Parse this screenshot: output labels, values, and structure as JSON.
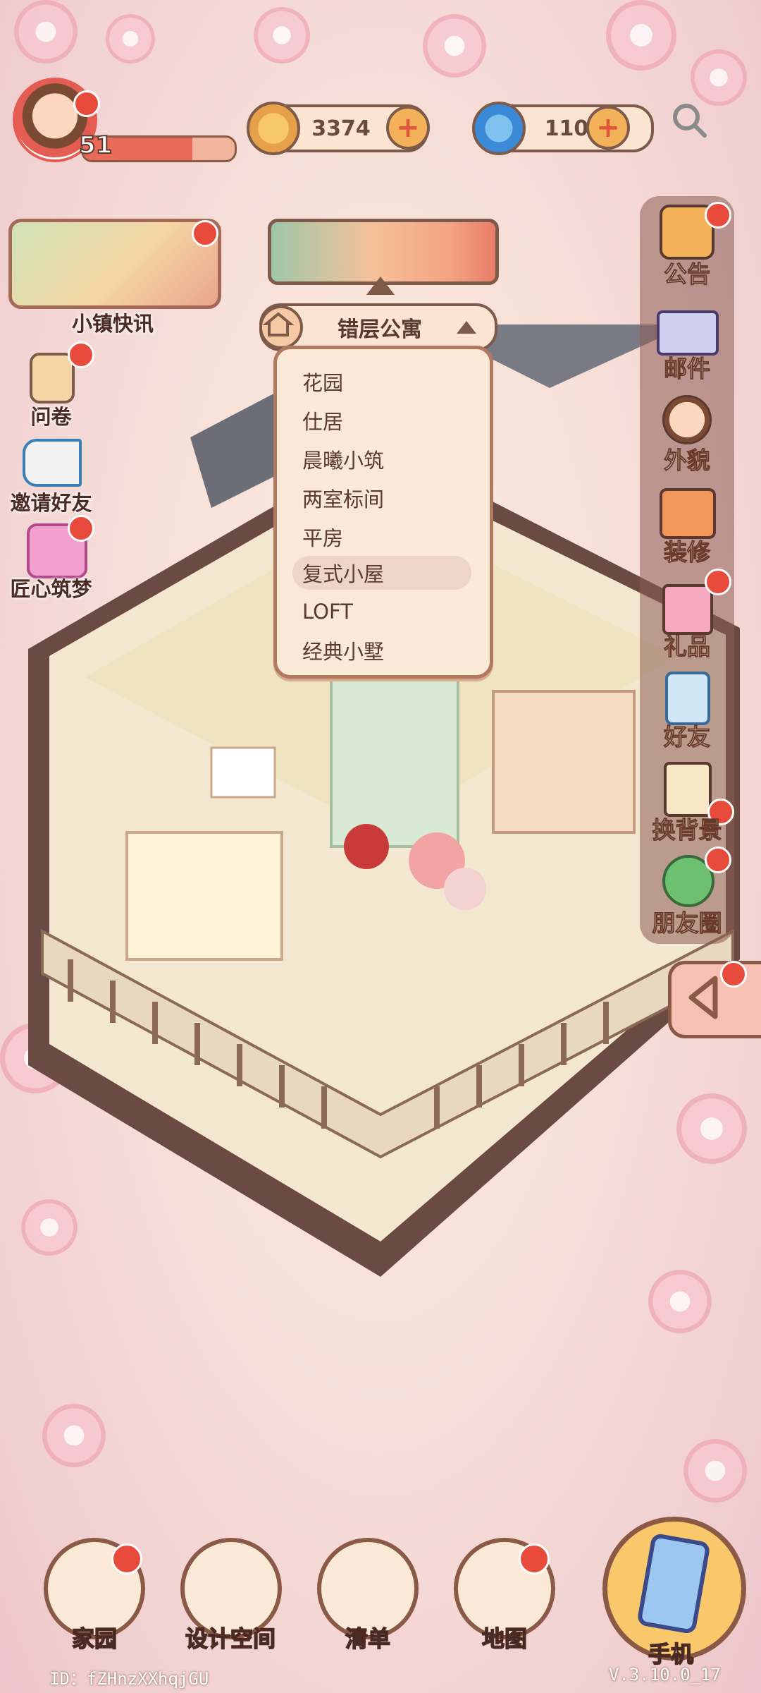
{
  "player": {
    "level": "51",
    "level_progress": 0.72
  },
  "currency": {
    "coins": "3374",
    "gems": "110"
  },
  "left_menu": {
    "news_label": "小镇快讯",
    "survey_label": "问卷",
    "invite_label": "邀请好友",
    "craft_label": "匠心筑梦"
  },
  "apartment": {
    "selected": "错层公寓",
    "options": [
      "花园",
      "仕居",
      "晨曦小筑",
      "两室标间",
      "平房",
      "复式小屋",
      "LOFT",
      "经典小墅"
    ],
    "highlighted": "复式小屋"
  },
  "right_menu": {
    "notice": "公告",
    "mail": "邮件",
    "appearance": "外貌",
    "decorate": "装修",
    "gift": "礼品",
    "friends": "好友",
    "background": "换背景",
    "moments": "朋友圈"
  },
  "bottom_nav": {
    "home": "家园",
    "design": "设计空间",
    "list": "清单",
    "map": "地图",
    "phone": "手机"
  },
  "footer": {
    "id": "ID：fZHnzXXhqjGU",
    "version": "V.3.10.0_17"
  },
  "colors": {
    "badge": "#e84b3c",
    "accent": "#7e5a4a",
    "panel": "#fbe9d8"
  }
}
